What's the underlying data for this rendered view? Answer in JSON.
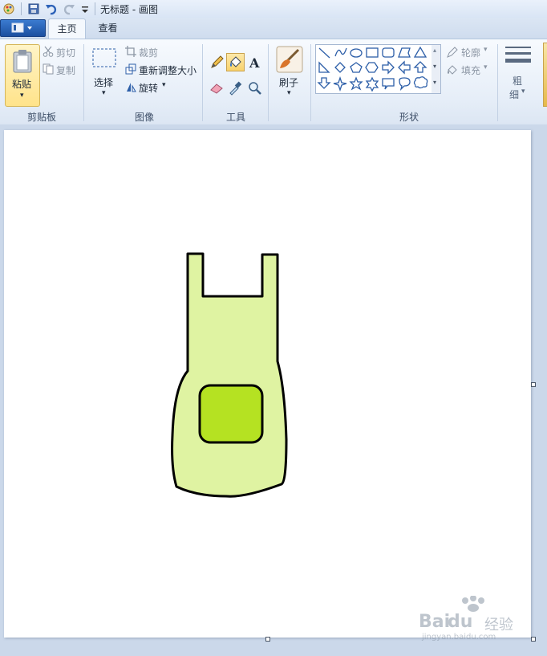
{
  "window": {
    "title": "无标题 - 画图"
  },
  "tabs": [
    {
      "label": "主页",
      "active": true
    },
    {
      "label": "查看",
      "active": false
    }
  ],
  "clipboard": {
    "paste": "粘贴",
    "cut": "剪切",
    "copy": "复制",
    "group": "剪贴板"
  },
  "image": {
    "select": "选择",
    "crop": "裁剪",
    "resize": "重新调整大小",
    "rotate": "旋转",
    "group": "图像"
  },
  "tools": {
    "group": "工具"
  },
  "brushes": {
    "label": "刷子"
  },
  "shapes": {
    "outline": "轮廓",
    "fill": "填充",
    "group": "形状"
  },
  "size": {
    "label1": "粗",
    "label2": "细"
  },
  "canvas_drawing": {
    "apron_fill": "#dff3a2",
    "pocket_fill": "#b5e222",
    "outline": "#000000"
  },
  "watermark": {
    "brand": "Bai",
    "brand_cn": "经验",
    "url": "jingyan.baidu.com"
  }
}
